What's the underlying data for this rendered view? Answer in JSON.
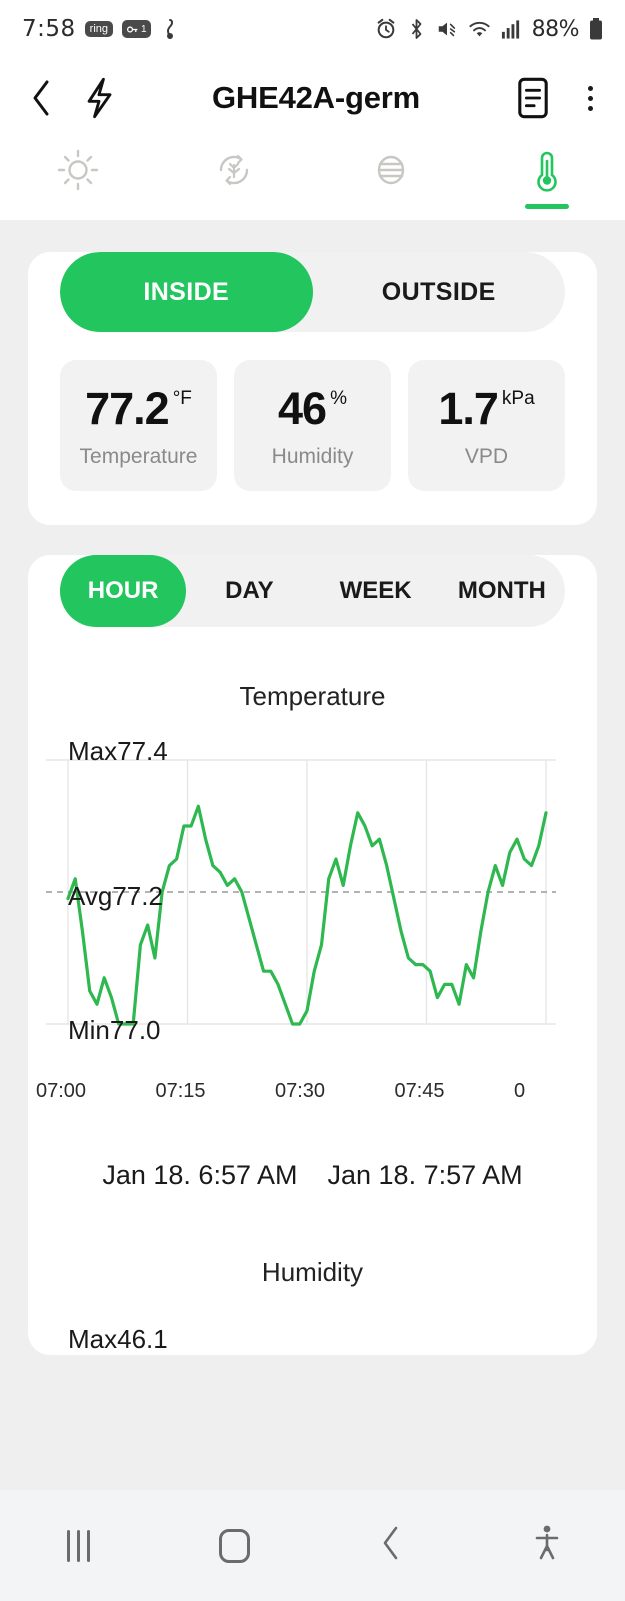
{
  "status_bar": {
    "time": "7:58",
    "ring_chip": "ring",
    "sim_chip": "1",
    "battery_percent": "88%",
    "icons": [
      "ring-chip-icon",
      "sim-card-icon",
      "do-not-disturb-icon",
      "alarm-icon",
      "bluetooth-icon",
      "mute-icon",
      "wifi-icon",
      "cellular-signal-icon",
      "battery-icon"
    ]
  },
  "app_bar": {
    "title": "GHE42A-germ",
    "back_icon": "chevron-left-icon",
    "bolt_icon": "lightning-bolt-icon",
    "notes_icon": "document-icon",
    "overflow_icon": "kebab-menu-icon"
  },
  "icon_tabs": [
    {
      "name": "light",
      "icon": "sun-icon",
      "active": false
    },
    {
      "name": "cycle",
      "icon": "plant-cycle-icon",
      "active": false
    },
    {
      "name": "airflow",
      "icon": "circulation-icon",
      "active": false
    },
    {
      "name": "temperature",
      "icon": "thermometer-icon",
      "active": true
    }
  ],
  "location_toggle": {
    "options": [
      "INSIDE",
      "OUTSIDE"
    ],
    "selected": "INSIDE"
  },
  "metrics": [
    {
      "value": "77.2",
      "unit": "°F",
      "label": "Temperature"
    },
    {
      "value": "46",
      "unit": "%",
      "label": "Humidity"
    },
    {
      "value": "1.7",
      "unit": "kPa",
      "label": "VPD"
    }
  ],
  "range_tabs": {
    "options": [
      "HOUR",
      "DAY",
      "WEEK",
      "MONTH"
    ],
    "selected": "HOUR"
  },
  "date_range": {
    "start": "Jan 18. 6:57 AM",
    "end": "Jan 18. 7:57 AM"
  },
  "humidity_section": {
    "title": "Humidity",
    "max_label": "Max46.1"
  },
  "nav_bar": {
    "recents": "recents-icon",
    "home": "home-icon",
    "back": "back-icon",
    "accessibility": "accessibility-icon"
  },
  "colors": {
    "accent": "#22c55e",
    "line": "#2eb84f",
    "surface": "#ffffff",
    "page_bg": "#efefef",
    "muted_text": "#8a8a8a"
  },
  "chart_data": {
    "type": "line",
    "title": "Temperature",
    "xlabel": "",
    "ylabel": "",
    "grid": true,
    "legend": null,
    "max_label": "Max77.4",
    "avg_label": "Avg77.2",
    "min_label": "Min77.0",
    "max": 77.4,
    "avg": 77.2,
    "min": 77.0,
    "ylim": [
      77.0,
      77.4
    ],
    "avg_reference_line": 77.2,
    "xtick_labels": [
      "07:00",
      "07:15",
      "07:30",
      "07:45",
      "0"
    ],
    "x_start": "Jan 18. 6:57 AM",
    "x_end": "Jan 18. 7:57 AM",
    "series": [
      {
        "name": "Temperature",
        "color": "#2eb84f",
        "values": [
          77.19,
          77.22,
          77.14,
          77.05,
          77.03,
          77.07,
          77.04,
          77.0,
          77.0,
          77.0,
          77.12,
          77.15,
          77.1,
          77.2,
          77.24,
          77.25,
          77.3,
          77.3,
          77.33,
          77.28,
          77.24,
          77.23,
          77.21,
          77.22,
          77.2,
          77.16,
          77.12,
          77.08,
          77.08,
          77.06,
          77.03,
          77.0,
          77.0,
          77.02,
          77.08,
          77.12,
          77.22,
          77.25,
          77.21,
          77.27,
          77.32,
          77.3,
          77.27,
          77.28,
          77.24,
          77.19,
          77.14,
          77.1,
          77.09,
          77.09,
          77.08,
          77.04,
          77.06,
          77.06,
          77.03,
          77.09,
          77.07,
          77.14,
          77.2,
          77.24,
          77.21,
          77.26,
          77.28,
          77.25,
          77.24,
          77.27,
          77.32
        ]
      }
    ]
  }
}
